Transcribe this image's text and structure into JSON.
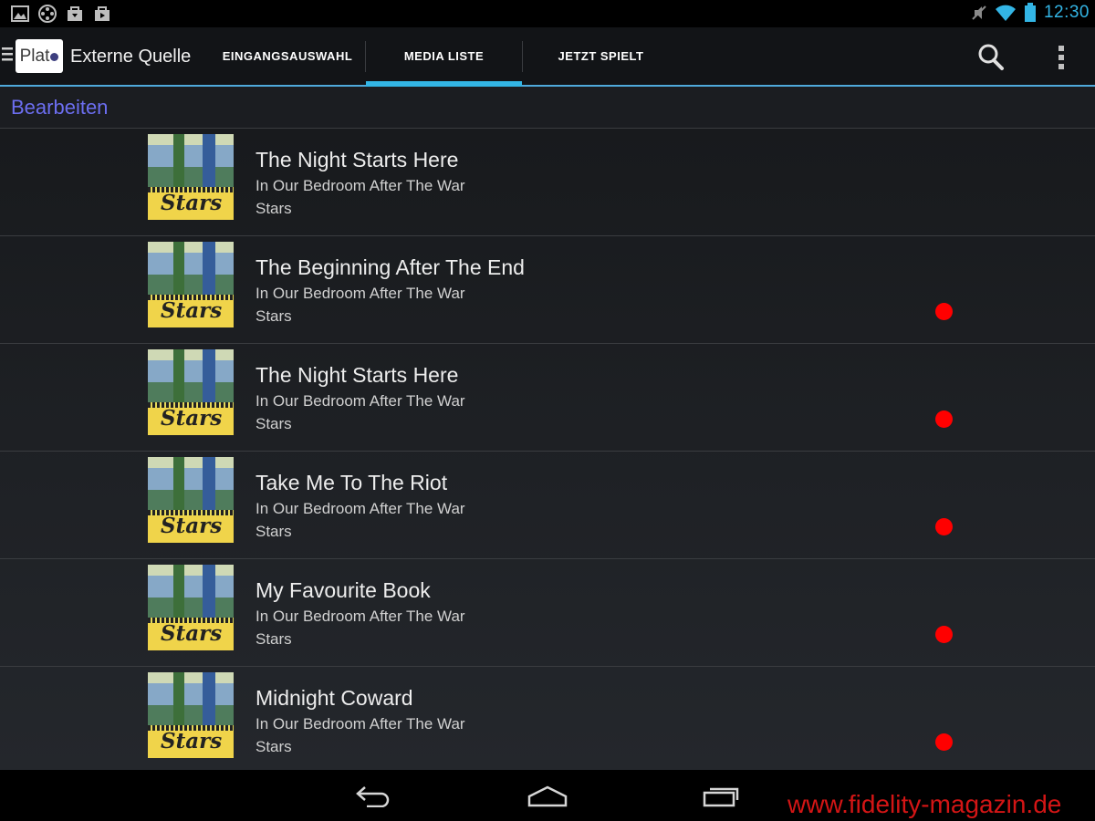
{
  "status_bar": {
    "time": "12:30",
    "colors": {
      "time": "#33b5e5"
    },
    "left_icons": [
      "image-icon",
      "media-player-icon",
      "download-store-icon",
      "shopping-bag-icon"
    ],
    "right_icons": [
      "mute-icon",
      "wifi-icon",
      "battery-icon"
    ]
  },
  "action_bar": {
    "logo_text": "Plato",
    "title": "Externe Quelle",
    "tabs": [
      {
        "label": "EINGANGSAUSWAHL",
        "active": false
      },
      {
        "label": "MEDIA LISTE",
        "active": true
      },
      {
        "label": "JETZT SPIELT",
        "active": false
      }
    ],
    "colors": {
      "accent": "#33b5e5"
    }
  },
  "edit_bar": {
    "label": "Bearbeiten",
    "color": "#6c6ef0"
  },
  "tracks": [
    {
      "title": "The Night Starts Here",
      "album": "In Our Bedroom After The War",
      "artist": "Stars",
      "cover_text": "Stars",
      "marked": false
    },
    {
      "title": "The Beginning After The End",
      "album": "In Our Bedroom After The War",
      "artist": "Stars",
      "cover_text": "Stars",
      "marked": true
    },
    {
      "title": "The Night Starts Here",
      "album": "In Our Bedroom After The War",
      "artist": "Stars",
      "cover_text": "Stars",
      "marked": true
    },
    {
      "title": "Take Me To The Riot",
      "album": "In Our Bedroom After The War",
      "artist": "Stars",
      "cover_text": "Stars",
      "marked": true
    },
    {
      "title": "My Favourite Book",
      "album": "In Our Bedroom After The War",
      "artist": "Stars",
      "cover_text": "Stars",
      "marked": true
    },
    {
      "title": "Midnight Coward",
      "album": "In Our Bedroom After The War",
      "artist": "Stars",
      "cover_text": "Stars",
      "marked": true
    }
  ],
  "marker_color": "#ff0000",
  "nav_bar": {
    "icons": [
      "back-icon",
      "home-icon",
      "recent-apps-icon"
    ]
  },
  "watermark": "www.fidelity-magazin.de"
}
